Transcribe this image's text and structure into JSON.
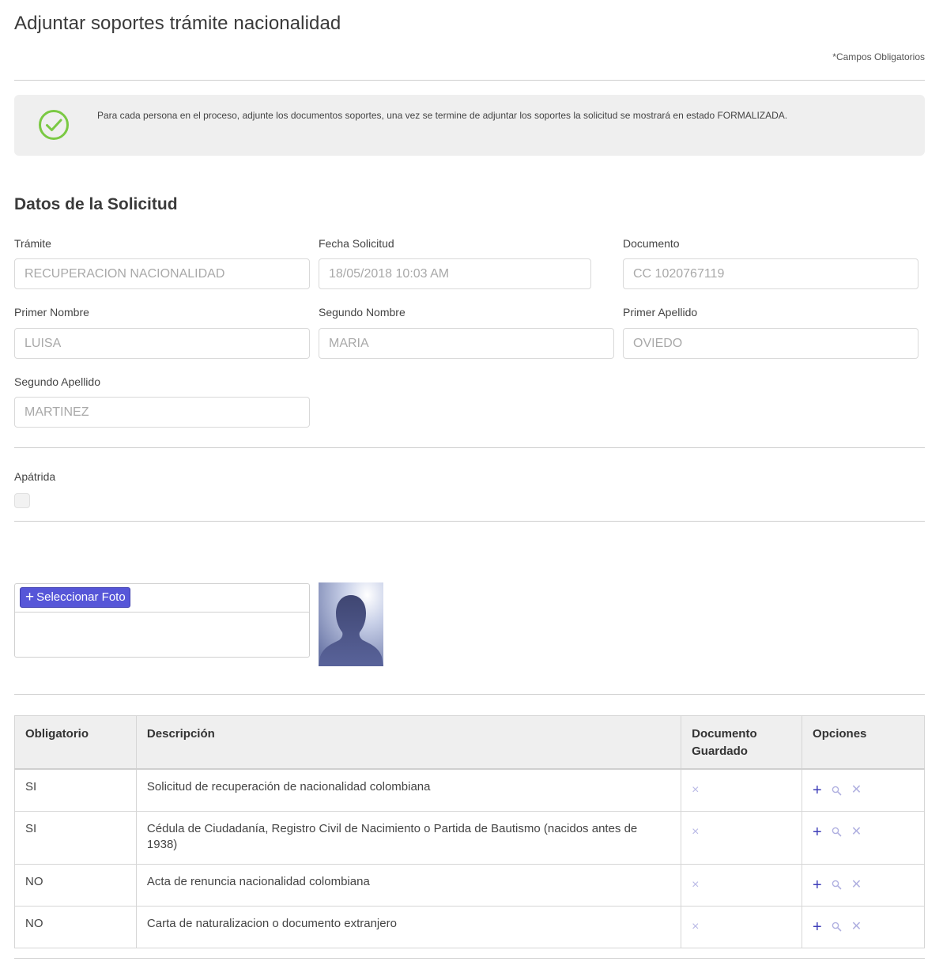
{
  "page": {
    "title": "Adjuntar soportes trámite nacionalidad",
    "required_note": "*Campos Obligatorios"
  },
  "info": {
    "icon": "check-circle-icon",
    "icon_color": "#7ac943",
    "text": "Para cada persona en el proceso, adjunte los documentos soportes, una vez se termine de adjuntar los soportes la solicitud se mostrará en estado FORMALIZADA."
  },
  "solicitud": {
    "title": "Datos de la Solicitud",
    "fields": {
      "tramite": {
        "label": "Trámite",
        "value": "RECUPERACION NACIONALIDAD"
      },
      "fecha": {
        "label": "Fecha Solicitud",
        "value": "18/05/2018 10:03 AM"
      },
      "documento": {
        "label": "Documento",
        "value": "CC 1020767119"
      },
      "primer_nombre": {
        "label": "Primer Nombre",
        "value": "LUISA"
      },
      "segundo_nombre": {
        "label": "Segundo Nombre",
        "value": "MARIA"
      },
      "primer_apellido": {
        "label": "Primer Apellido",
        "value": "OVIEDO"
      },
      "segundo_apellido": {
        "label": "Segundo Apellido",
        "value": "MARTINEZ"
      }
    },
    "apatrida": {
      "label": "Apátrida",
      "checked": false
    }
  },
  "foto": {
    "button_label": "Seleccionar Foto",
    "button_icon": "plus-icon",
    "button_color": "#5656d8",
    "avatar": "person-silhouette-icon"
  },
  "documentos": {
    "headers": {
      "obligatorio": "Obligatorio",
      "descripcion": "Descripción",
      "guardado": "Documento Guardado",
      "opciones": "Opciones"
    },
    "rows": [
      {
        "obligatorio": "SI",
        "descripcion": "Solicitud de recuperación de nacionalidad colombiana",
        "guardado": "×"
      },
      {
        "obligatorio": "SI",
        "descripcion": "Cédula de Ciudadanía, Registro Civil de Nacimiento o Partida de Bautismo (nacidos antes de 1938)",
        "guardado": "×"
      },
      {
        "obligatorio": "NO",
        "descripcion": "Acta de renuncia nacionalidad colombiana",
        "guardado": "×"
      },
      {
        "obligatorio": "NO",
        "descripcion": "Carta de naturalizacion o documento extranjero",
        "guardado": "×"
      }
    ],
    "option_icons": [
      "plus-icon",
      "search-icon",
      "close-icon"
    ]
  }
}
